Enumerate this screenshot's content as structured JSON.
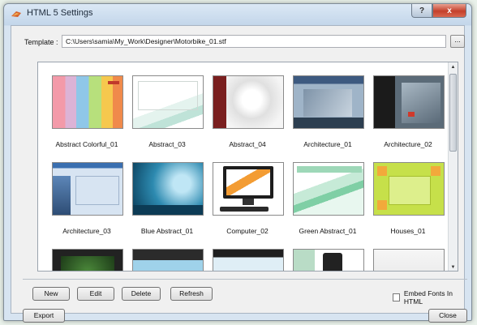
{
  "window": {
    "title": "HTML 5 Settings",
    "help_label": "?",
    "close_label": "x"
  },
  "template": {
    "label": "Template :",
    "path": "C:\\Users\\samia\\My_Work\\Designer\\Motorbike_01.stf",
    "browse_label": "..."
  },
  "gallery": {
    "items": [
      {
        "name": "Abstract Colorful_01"
      },
      {
        "name": "Abstract_03"
      },
      {
        "name": "Abstract_04"
      },
      {
        "name": "Architecture_01"
      },
      {
        "name": "Architecture_02"
      },
      {
        "name": "Architecture_03"
      },
      {
        "name": "Blue Abstract_01"
      },
      {
        "name": "Computer_02"
      },
      {
        "name": "Green Abstract_01"
      },
      {
        "name": "Houses_01"
      }
    ],
    "scroll_up": "▲",
    "scroll_down": "▼"
  },
  "actions": {
    "new": "New",
    "edit": "Edit",
    "delete": "Delete",
    "refresh": "Refresh"
  },
  "embed_fonts": {
    "label": "Embed Fonts In HTML",
    "checked": false
  },
  "footer": {
    "export": "Export",
    "close": "Close"
  }
}
